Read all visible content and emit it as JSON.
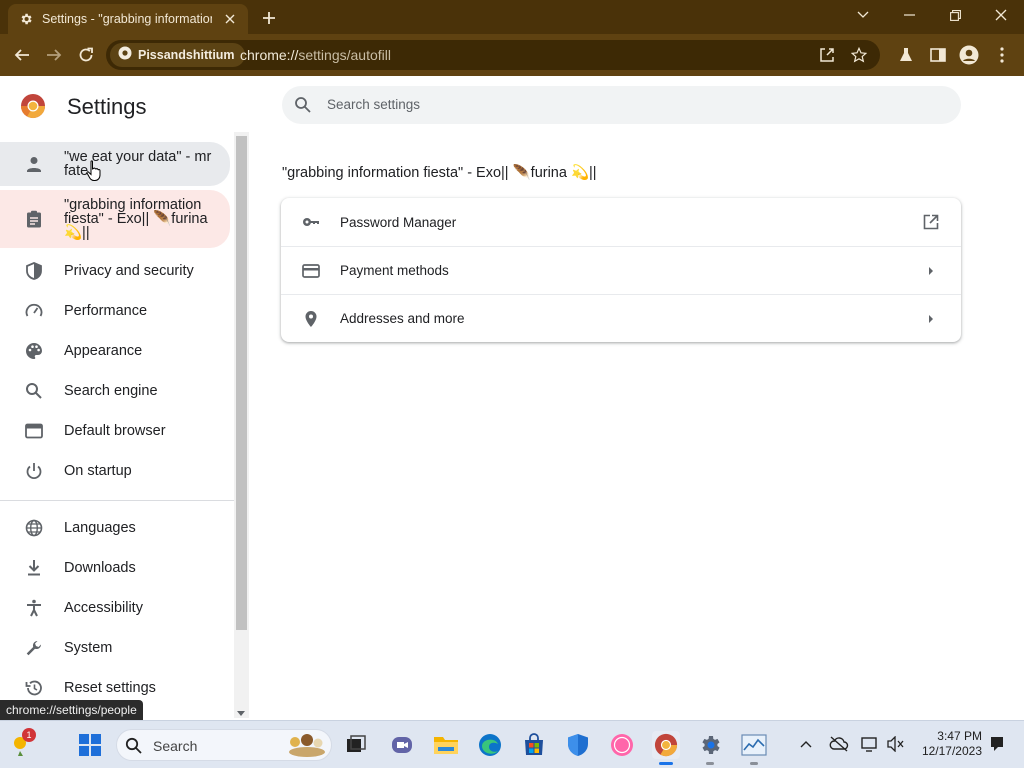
{
  "browser": {
    "tab": {
      "title": "Settings - \"grabbing information fiesta\" - Exo",
      "icon": "gear-icon"
    },
    "window_controls": [
      "chevron-down-icon",
      "minimize-icon",
      "restore-icon",
      "close-icon"
    ],
    "site_chip": "Pissandshittium",
    "url_host": "chrome://",
    "url_path": "settings/autofill",
    "accent": "#5f4211"
  },
  "settings": {
    "title": "Settings",
    "search_placeholder": "Search settings",
    "sidebar": [
      {
        "label": "\"we eat your data\" - mr fate",
        "icon": "person-icon",
        "state": "hover"
      },
      {
        "label": "\"grabbing information fiesta\" - Exo|| 🪶furina 💫||",
        "icon": "clipboard-icon",
        "state": "active"
      },
      {
        "label": "Privacy and security",
        "icon": "shield-icon"
      },
      {
        "label": "Performance",
        "icon": "speedometer-icon"
      },
      {
        "label": "Appearance",
        "icon": "palette-icon"
      },
      {
        "label": "Search engine",
        "icon": "search-icon"
      },
      {
        "label": "Default browser",
        "icon": "browser-window-icon"
      },
      {
        "label": "On startup",
        "icon": "power-icon"
      },
      {
        "label": "Languages",
        "icon": "globe-icon"
      },
      {
        "label": "Downloads",
        "icon": "download-icon"
      },
      {
        "label": "Accessibility",
        "icon": "accessibility-icon"
      },
      {
        "label": "System",
        "icon": "wrench-icon"
      },
      {
        "label": "Reset settings",
        "icon": "history-icon"
      }
    ],
    "section_title": "\"grabbing information fiesta\" - Exo|| 🪶furina 💫||",
    "autofill_rows": [
      {
        "label": "Password Manager",
        "icon": "key-icon",
        "trailing": "open-external-icon"
      },
      {
        "label": "Payment methods",
        "icon": "credit-card-icon",
        "trailing": "arrow-right-icon"
      },
      {
        "label": "Addresses and more",
        "icon": "location-pin-icon",
        "trailing": "arrow-right-icon"
      }
    ]
  },
  "status_bar_url": "chrome://settings/people",
  "taskbar": {
    "search_label": "Search",
    "notification_count": "1",
    "time": "3:47 PM",
    "date": "12/17/2023"
  }
}
